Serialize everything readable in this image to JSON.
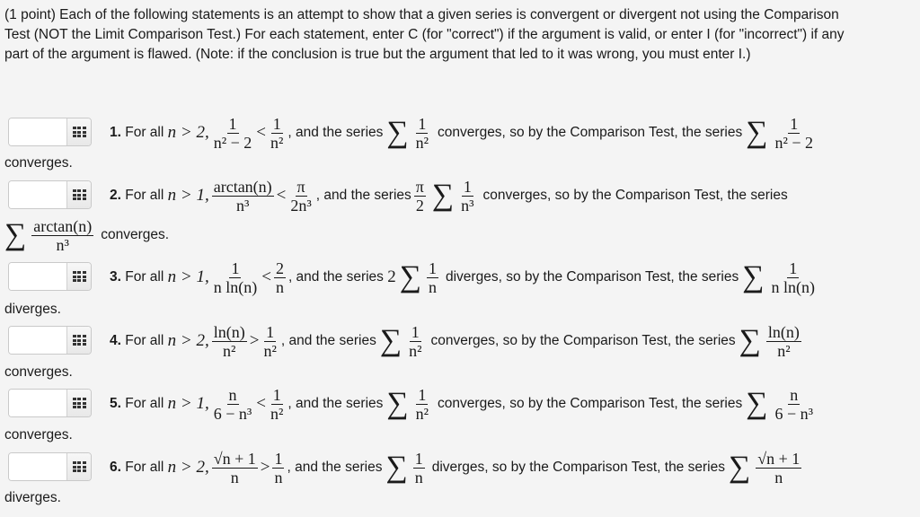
{
  "intro": {
    "line1": "(1 point) Each of the following statements is an attempt to show that a given series is convergent or divergent not using the Comparison",
    "line2": "Test (NOT the Limit Comparison Test.) For each statement, enter C (for \"correct\") if the argument is valid, or enter I (for \"incorrect\") if any",
    "line3": "part of the argument is flawed. (Note: if the conclusion is true but the argument that led to it was wrong, you must enter I.)"
  },
  "common": {
    "for_all": "For all",
    "and_the_series": ", and the series",
    "so_by": "so by the Comparison Test, the series",
    "converges_comma": "converges,",
    "diverges_comma": "diverges,",
    "palette_icon": "grid-palette-icon"
  },
  "answers": [
    {
      "value": "",
      "placeholder": ""
    },
    {
      "value": "",
      "placeholder": ""
    },
    {
      "value": "",
      "placeholder": ""
    },
    {
      "value": "",
      "placeholder": ""
    },
    {
      "value": "",
      "placeholder": ""
    },
    {
      "value": "",
      "placeholder": ""
    }
  ],
  "statements": [
    {
      "number": "1.",
      "cond": "n > 2,",
      "lhs_num": "1",
      "lhs_den": "n² − 2",
      "rel": "<",
      "rhs_num": "1",
      "rhs_den": "n²",
      "coef": "",
      "cmp_num": "1",
      "cmp_den": "n²",
      "cmp_result": "converges,",
      "target_num": "1",
      "target_den": "n² − 2",
      "conclusion": "converges."
    },
    {
      "number": "2.",
      "cond": "n > 1,",
      "lhs_num": "arctan(n)",
      "lhs_den": "n³",
      "rel": "<",
      "rhs_num": "π",
      "rhs_den": "2n³",
      "coef_num": "π",
      "coef_den": "2",
      "cmp_num": "1",
      "cmp_den": "n³",
      "cmp_result": "converges,",
      "target_num": "arctan(n)",
      "target_den": "n³",
      "conclusion": "converges."
    },
    {
      "number": "3.",
      "cond": "n > 1,",
      "lhs_num": "1",
      "lhs_den": "n ln(n)",
      "rel": "<",
      "rhs_num": "2",
      "rhs_den": "n",
      "coef": "2",
      "cmp_num": "1",
      "cmp_den": "n",
      "cmp_result": "diverges,",
      "target_num": "1",
      "target_den": "n ln(n)",
      "conclusion": "diverges."
    },
    {
      "number": "4.",
      "cond": "n > 2,",
      "lhs_num": "ln(n)",
      "lhs_den": "n²",
      "rel": ">",
      "rhs_num": "1",
      "rhs_den": "n²",
      "coef": "",
      "cmp_num": "1",
      "cmp_den": "n²",
      "cmp_result": "converges,",
      "target_num": "ln(n)",
      "target_den": "n²",
      "conclusion": "converges."
    },
    {
      "number": "5.",
      "cond": "n > 1,",
      "lhs_num": "n",
      "lhs_den": "6 − n³",
      "rel": "<",
      "rhs_num": "1",
      "rhs_den": "n²",
      "coef": "",
      "cmp_num": "1",
      "cmp_den": "n²",
      "cmp_result": "converges,",
      "target_num": "n",
      "target_den": "6 − n³",
      "conclusion": "converges."
    },
    {
      "number": "6.",
      "cond": "n > 2,",
      "lhs_num": "√n + 1",
      "lhs_den": "n",
      "rel": ">",
      "rhs_num": "1",
      "rhs_den": "n",
      "coef": "",
      "cmp_num": "1",
      "cmp_den": "n",
      "cmp_result": "diverges,",
      "target_num": "√n + 1",
      "target_den": "n",
      "conclusion": "diverges."
    }
  ]
}
